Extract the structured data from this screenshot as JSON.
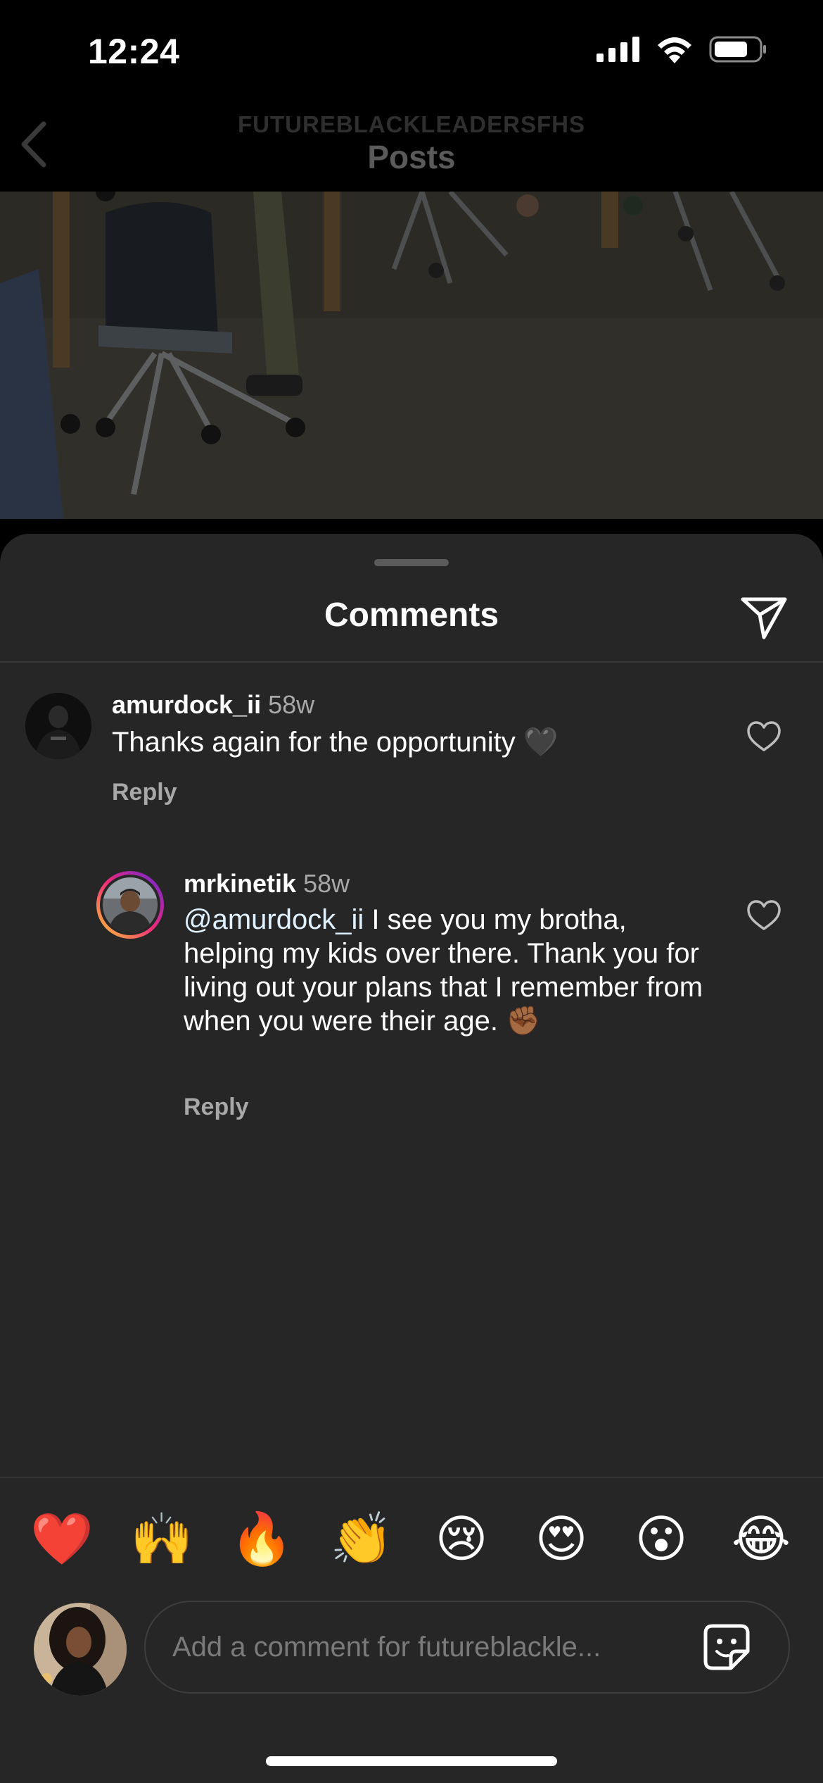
{
  "status_bar": {
    "time": "12:24"
  },
  "nav": {
    "account": "FUTUREBLACKLEADERSFHS",
    "title": "Posts"
  },
  "comments_sheet": {
    "title": "Comments",
    "comments": [
      {
        "username": "amurdock_ii",
        "time": "58w",
        "text": "Thanks again for the opportunity 🖤",
        "reply_label": "Reply"
      },
      {
        "username": "mrkinetik",
        "time": "58w",
        "mention": "@amurdock_ii",
        "text": " I see you my brotha, helping my kids over there. Thank you for living out your plans that I remember from when you were their age. ✊🏾",
        "reply_label": "Reply"
      }
    ],
    "quick_reactions": [
      "❤️",
      "🙌",
      "🔥",
      "👏",
      "😢",
      "😍",
      "😮",
      "😂"
    ],
    "input": {
      "placeholder": "Add a comment for futureblackle..."
    }
  },
  "colors": {
    "background": "#000000",
    "sheet": "#262626",
    "secondary_text": "#a8a8a8",
    "story_ring": [
      "#f9ce34",
      "#ee2a7b",
      "#6228d7"
    ]
  },
  "icons": [
    "back-chevron-icon",
    "share-direct-icon",
    "heart-outline-icon",
    "sticker-icon",
    "cellular-icon",
    "wifi-icon",
    "battery-icon"
  ]
}
